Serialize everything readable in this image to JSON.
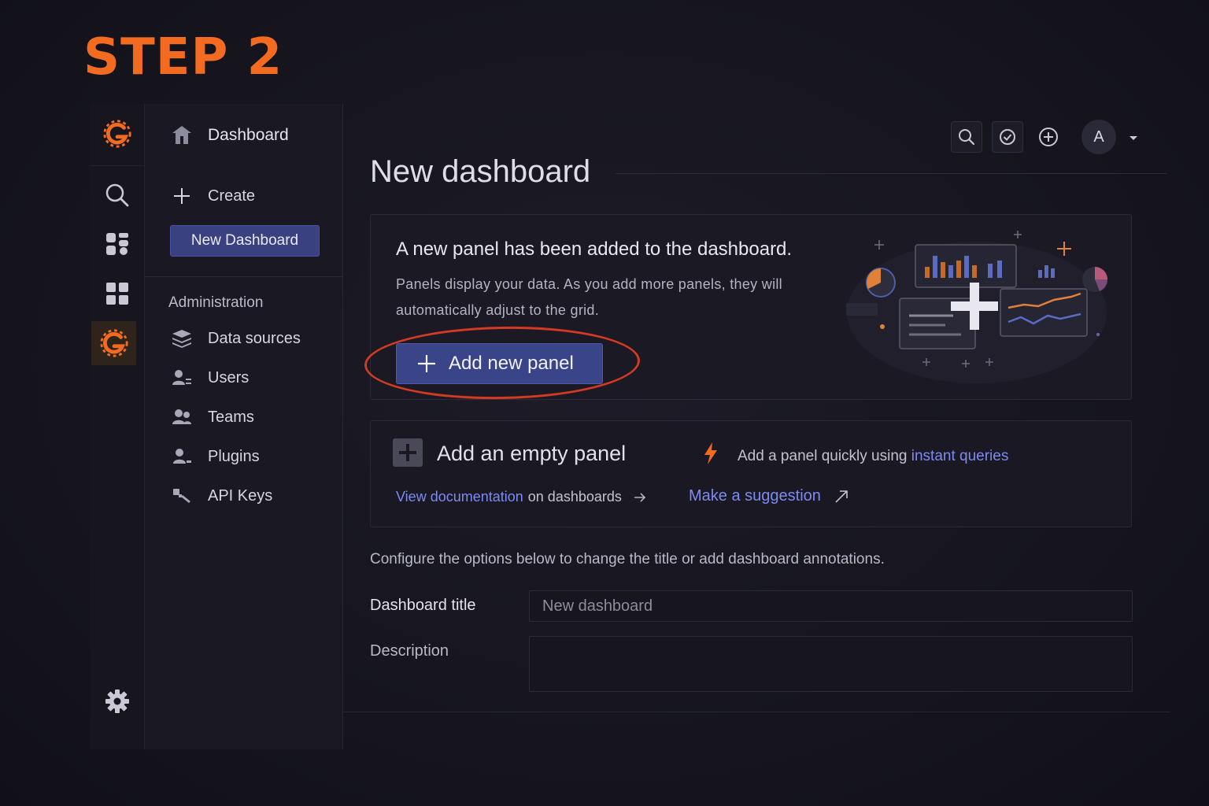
{
  "step_label": "STEP 2",
  "colors": {
    "brand": "#f26b21",
    "primary": "#3a4488",
    "link": "#7d8af0",
    "highlight": "#d33a24"
  },
  "rail": {
    "icons": [
      "grafana-logo-icon",
      "search-icon",
      "dashboards-icon",
      "grid-icon",
      "grafana-admin-icon",
      "gear-icon"
    ]
  },
  "menu": {
    "header": "Dashboard",
    "create": "Create",
    "new_dashboard": "New Dashboard",
    "admin_label": "Administration",
    "items": [
      {
        "label": "Data sources",
        "icon": "database-icon"
      },
      {
        "label": "Users",
        "icon": "users-icon"
      },
      {
        "label": "Teams",
        "icon": "teams-icon"
      },
      {
        "label": "Plugins",
        "icon": "plugins-icon"
      },
      {
        "label": "API Keys",
        "icon": "key-icon"
      }
    ]
  },
  "topbar": {
    "avatar_initial": "A"
  },
  "main": {
    "title": "New dashboard",
    "panel_card": {
      "heading": "A new panel has been added to the dashboard.",
      "body": "Panels display your data. As you add more panels, they will automatically adjust to the grid.",
      "button": "Add new panel"
    },
    "empty_card": {
      "title": "Add an empty panel",
      "quick_prefix": "Add a panel quickly using",
      "quick_link": "instant queries",
      "doc_link": "View documentation",
      "doc_suffix": "on dashboards",
      "suggest": "Make a suggestion"
    },
    "config_text": "Configure the options below to change the title or add dashboard annotations.",
    "title_label": "Dashboard title",
    "title_value": "New dashboard",
    "description_label": "Description",
    "description_value": ""
  }
}
